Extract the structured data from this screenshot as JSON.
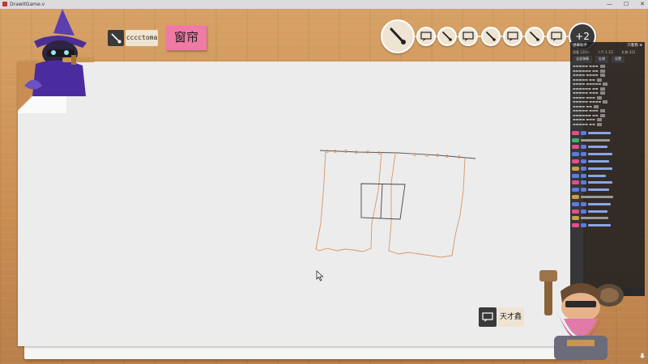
{
  "window": {
    "title": "DrawItGame.v",
    "controls": [
      "—",
      "☐",
      "✕"
    ]
  },
  "drawer": {
    "name": "cccctoma",
    "icon": "brush-icon"
  },
  "prompt_word": "窗帘",
  "tools": {
    "items": [
      "brush-icon",
      "chat-bubble-icon",
      "brush-icon",
      "chat-bubble-icon",
      "brush-icon",
      "chat-bubble-icon",
      "brush-icon",
      "chat-bubble-icon"
    ],
    "more_label": "+2"
  },
  "chat": {
    "header_title": "弹幕助手",
    "header_right": "只看我 ⊕",
    "stats": [
      "观看 120人",
      "人气 1.3万",
      "礼物 322"
    ],
    "tabs": [
      "全部弹幕",
      "礼物",
      "设置"
    ]
  },
  "hint": {
    "icon": "chat-bubble-icon",
    "name": "天才鑫"
  },
  "colors": {
    "paper": "#ececec",
    "wood": "#c98d52",
    "word_card": "#f07aa6",
    "curtain_stroke": "#d99566",
    "window_stroke": "#444444"
  }
}
